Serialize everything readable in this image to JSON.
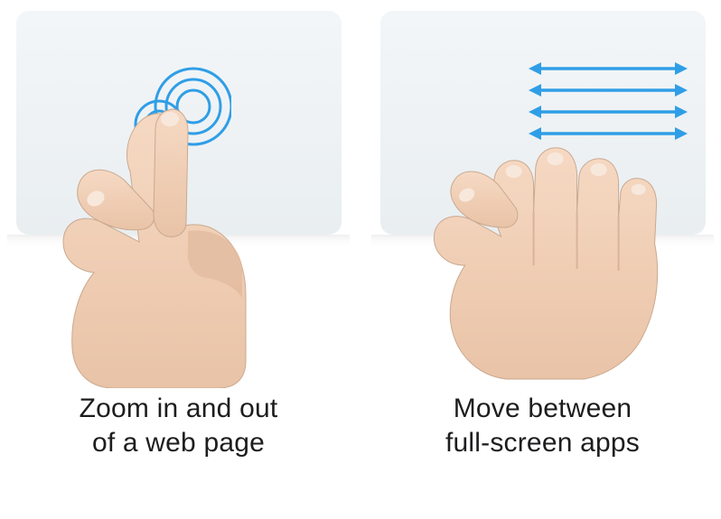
{
  "gestures": [
    {
      "id": "pinch-zoom",
      "caption_line1": "Zoom in and out",
      "caption_line2": "of a web page",
      "indicator": "concentric-rings",
      "fingers_on_pad": 2
    },
    {
      "id": "swipe-fullscreen",
      "caption_line1": "Move between",
      "caption_line2": "full-screen apps",
      "indicator": "horizontal-arrows",
      "fingers_on_pad": 4,
      "arrow_rows": 4
    }
  ],
  "colors": {
    "indicator_blue": "#2f9ee6",
    "trackpad_surface": "#eef2f5",
    "skin": "#f2d1b9",
    "skin_shadow": "#d9b49b"
  }
}
